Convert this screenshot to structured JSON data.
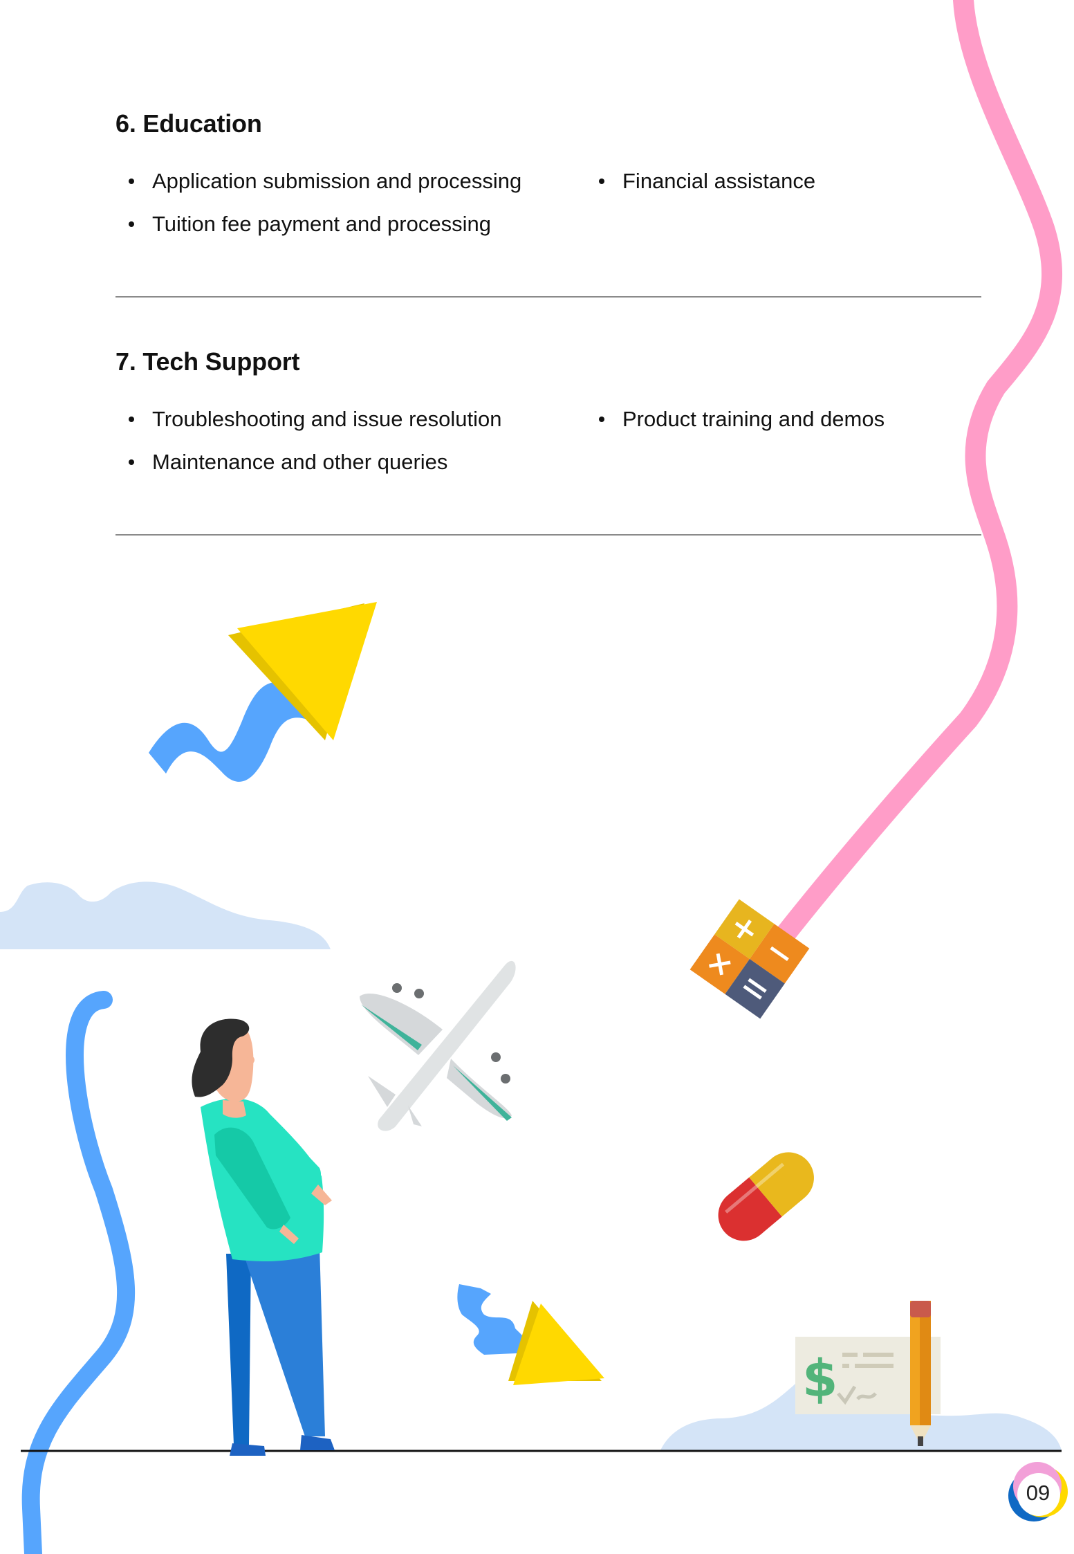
{
  "sections": [
    {
      "title": "6. Education",
      "left_items": [
        "Application submission and processing",
        "Tuition fee payment and processing"
      ],
      "right_items": [
        "Financial assistance"
      ]
    },
    {
      "title": "7. Tech Support",
      "left_items": [
        "Troubleshooting and issue resolution",
        "Maintenance and other queries"
      ],
      "right_items": [
        "Product training and demos"
      ]
    }
  ],
  "page_number": "09",
  "illustration_icons": [
    "arrow-up-icon",
    "calculator-icon",
    "airplane-icon",
    "pill-icon",
    "arrow-down-icon",
    "check-pencil-icon",
    "person-figure",
    "cloud-shape"
  ],
  "colors": {
    "pink_ribbon": "#FF9DC8",
    "blue_ribbon": "#56A5FD",
    "yellow": "#FFD900",
    "cloud": "#D4E4F7"
  }
}
